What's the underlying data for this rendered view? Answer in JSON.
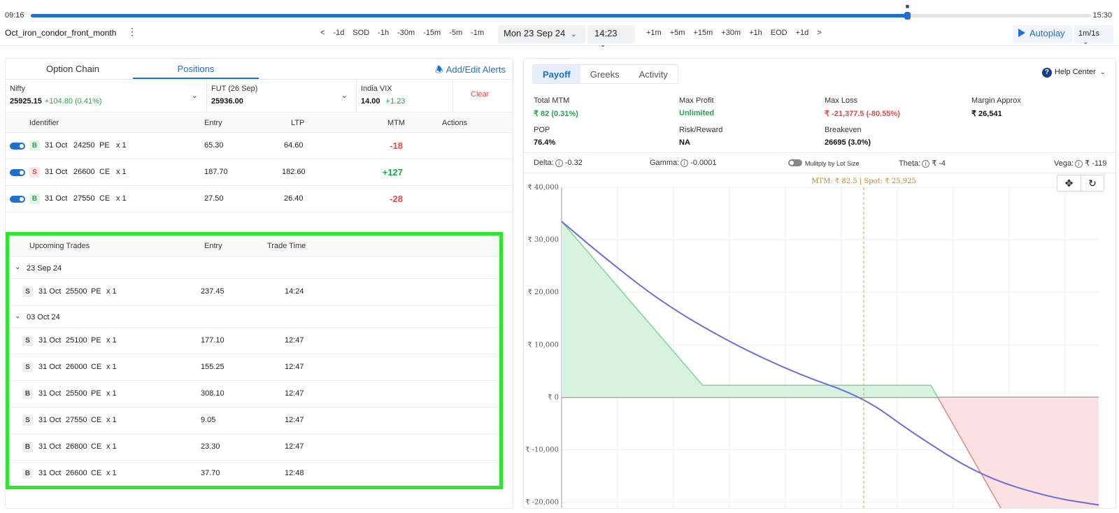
{
  "timeline": {
    "start": "09:16",
    "end": "15:30",
    "progress": 0.8265
  },
  "toolbar": {
    "strategy_name": "Oct_iron_condor_front_month",
    "back_steps": [
      "<",
      "-1d",
      "SOD",
      "-1h",
      "-30m",
      "-15m",
      "-5m",
      "-1m"
    ],
    "date": "Mon  23 Sep 24",
    "time": "14:23",
    "fwd_steps": [
      "+1m",
      "+5m",
      "+15m",
      "+30m",
      "+1h",
      "EOD",
      "+1d",
      ">"
    ],
    "autoplay": "Autoplay",
    "speed": "1m/1s"
  },
  "left": {
    "tabs": [
      "Option Chain",
      "Positions"
    ],
    "active_tab": "Positions",
    "alerts": "Add/Edit Alerts",
    "quotes": [
      {
        "label": "Nifty",
        "value": "25925.15",
        "change": "+104.80 (0.41%)"
      },
      {
        "label": "FUT (26 Sep)",
        "value": "25936.00",
        "change": ""
      },
      {
        "label": "India VIX",
        "value": "14.00",
        "change": "+1.23"
      }
    ],
    "clear": "Clear",
    "headers": {
      "identifier": "Identifier",
      "entry": "Entry",
      "ltp": "LTP",
      "mtm": "MTM",
      "actions": "Actions"
    },
    "positions": [
      {
        "side": "B",
        "expiry": "31 Oct",
        "strike": "24250",
        "type": "PE",
        "qty": "x 1",
        "entry": "65.30",
        "ltp": "64.60",
        "mtm": "-18"
      },
      {
        "side": "S",
        "expiry": "31 Oct",
        "strike": "26600",
        "type": "CE",
        "qty": "x 1",
        "entry": "187.70",
        "ltp": "182.60",
        "mtm": "+127"
      },
      {
        "side": "B",
        "expiry": "31 Oct",
        "strike": "27550",
        "type": "CE",
        "qty": "x 1",
        "entry": "27.50",
        "ltp": "26.40",
        "mtm": "-28"
      }
    ],
    "upcoming": {
      "headers": {
        "title": "Upcoming Trades",
        "entry": "Entry",
        "time": "Trade Time"
      },
      "groups": [
        {
          "date": "23 Sep 24",
          "trades": [
            {
              "side": "S",
              "expiry": "31 Oct",
              "strike": "25500",
              "type": "PE",
              "qty": "x 1",
              "entry": "237.45",
              "time": "14:24"
            }
          ]
        },
        {
          "date": "03 Oct 24",
          "trades": [
            {
              "side": "S",
              "expiry": "31 Oct",
              "strike": "25100",
              "type": "PE",
              "qty": "x 1",
              "entry": "177.10",
              "time": "12:47"
            },
            {
              "side": "S",
              "expiry": "31 Oct",
              "strike": "26000",
              "type": "CE",
              "qty": "x 1",
              "entry": "155.25",
              "time": "12:47"
            },
            {
              "side": "B",
              "expiry": "31 Oct",
              "strike": "25500",
              "type": "PE",
              "qty": "x 1",
              "entry": "308.10",
              "time": "12:47"
            },
            {
              "side": "S",
              "expiry": "31 Oct",
              "strike": "27550",
              "type": "CE",
              "qty": "x 1",
              "entry": "9.05",
              "time": "12:47"
            },
            {
              "side": "B",
              "expiry": "31 Oct",
              "strike": "26800",
              "type": "CE",
              "qty": "x 1",
              "entry": "23.30",
              "time": "12:47"
            },
            {
              "side": "B",
              "expiry": "31 Oct",
              "strike": "26600",
              "type": "CE",
              "qty": "x 1",
              "entry": "37.70",
              "time": "12:48"
            }
          ]
        }
      ]
    }
  },
  "right": {
    "tabs": [
      "Payoff",
      "Greeks",
      "Activity"
    ],
    "active_tab": "Payoff",
    "help": "Help Center",
    "stats": {
      "total_mtm": {
        "label": "Total MTM",
        "value": "₹ 82 (0.31%)"
      },
      "max_profit": {
        "label": "Max Profit",
        "value": "Unlimited"
      },
      "max_loss": {
        "label": "Max Loss",
        "value": "₹ -21,377.5 (-80.55%)"
      },
      "margin": {
        "label": "Margin Approx",
        "value": "₹ 26,541"
      },
      "pop": {
        "label": "POP",
        "value": "76.4%"
      },
      "risk_reward": {
        "label": "Risk/Reward",
        "value": "NA"
      },
      "breakeven": {
        "label": "Breakeven",
        "value": "26695 (3.0%)"
      }
    },
    "greeks": {
      "delta": {
        "label": "Delta:",
        "value": "-0.32"
      },
      "gamma": {
        "label": "Gamma:",
        "value": "-0.0001"
      },
      "multiply": "Mulitply by Lot Size",
      "theta": {
        "label": "Theta:",
        "value": "₹ -4"
      },
      "vega": {
        "label": "Vega:",
        "value": "₹ -119"
      }
    }
  },
  "chart_data": {
    "type": "line",
    "annotation": "MTM: ₹ 82.5  |  Spot: ₹ 25,925",
    "ylim": [
      -21500,
      40000
    ],
    "y_ticks": [
      "₹ 40,000",
      "₹ 30,000",
      "₹ 20,000",
      "₹ 10,000",
      "₹ 0",
      "₹ -10,000",
      "₹ -20,000"
    ],
    "y_tick_values": [
      40000,
      30000,
      20000,
      10000,
      0,
      -10000,
      -20000
    ],
    "grid": true,
    "series": [
      {
        "values": [
          [
            0,
            33500
          ],
          [
            0.12,
            27000
          ],
          [
            0.3,
            18000
          ],
          [
            0.5,
            10500
          ],
          [
            0.7,
            4500
          ],
          [
            0.9,
            0
          ],
          [
            1.05,
            -7000
          ],
          [
            1.25,
            -15000
          ],
          [
            1.45,
            -19000
          ],
          [
            1.6,
            -20500
          ]
        ]
      },
      {
        "values": [
          [
            0,
            33500
          ],
          [
            0.42,
            2300
          ],
          [
            1.1,
            2300
          ],
          [
            1.31,
            -21300
          ],
          [
            1.6,
            -21300
          ]
        ]
      }
    ],
    "spot_x": 0.9,
    "colors": {
      "mtm_line": "#6b6bdc",
      "profit_fill": "#d8f2e0",
      "profit_line": "#7fd39a",
      "loss_fill": "#fbe1e1",
      "loss_line": "#e08888",
      "spot_line": "#d9a23a"
    }
  }
}
